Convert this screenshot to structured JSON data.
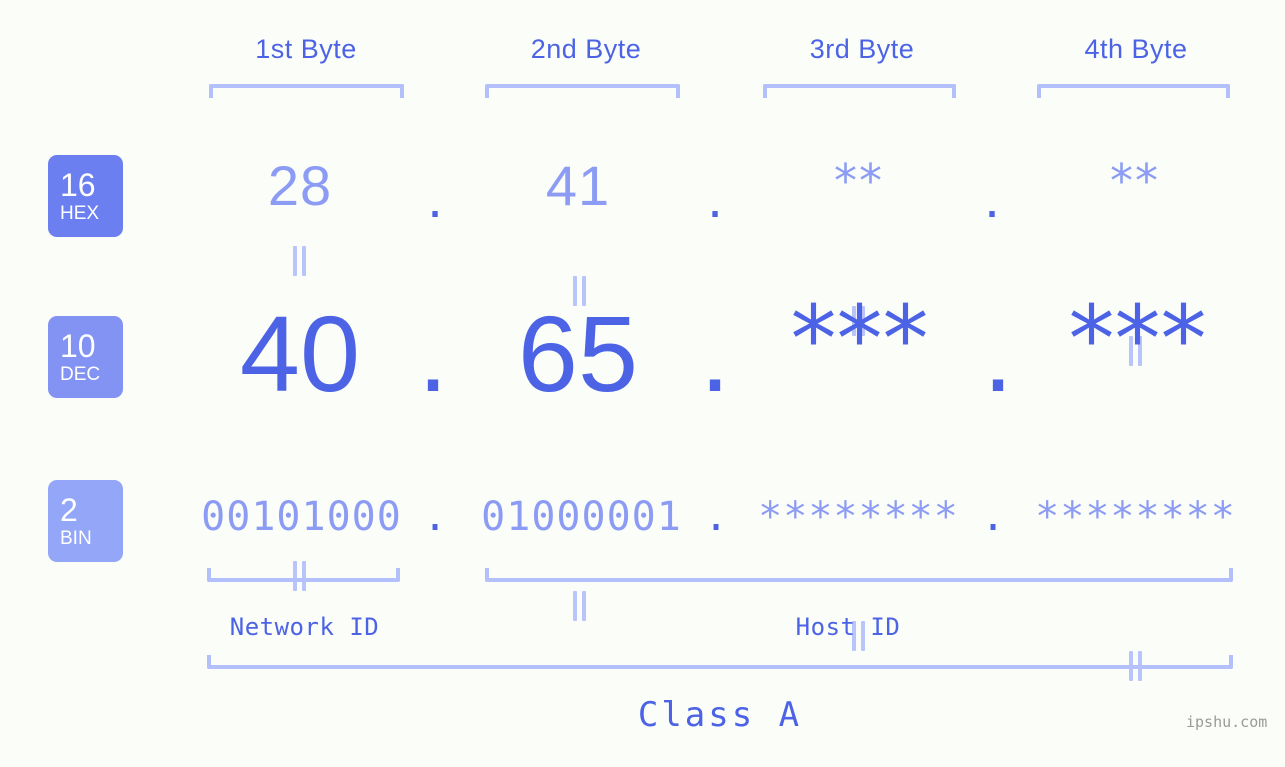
{
  "background_color": "#fbfdf8",
  "accent_dark": "#4c63e6",
  "accent_mid": "#8c9cf4",
  "accent_light": "#b3c0fb",
  "byte_headers": [
    {
      "label": "1st Byte"
    },
    {
      "label": "2nd Byte"
    },
    {
      "label": "3rd Byte"
    },
    {
      "label": "4th Byte"
    }
  ],
  "rows": {
    "hex": {
      "badge_number": "16",
      "badge_name": "HEX",
      "badge_color": "#6b7ff0",
      "values": [
        "28",
        "41",
        "**",
        "**"
      ],
      "separator": "."
    },
    "dec": {
      "badge_number": "10",
      "badge_name": "DEC",
      "badge_color": "#8293f3",
      "values": [
        "40",
        "65",
        "***",
        "***"
      ],
      "separator": "."
    },
    "bin": {
      "badge_number": "2",
      "badge_name": "BIN",
      "badge_color": "#93a6f7",
      "values": [
        "00101000",
        "01000001",
        "********",
        "********"
      ],
      "separator": "."
    }
  },
  "equals_symbol": "=",
  "segments": {
    "network_id": "Network ID",
    "host_id": "Host ID"
  },
  "class_label": "Class A",
  "watermark": "ipshu.com"
}
